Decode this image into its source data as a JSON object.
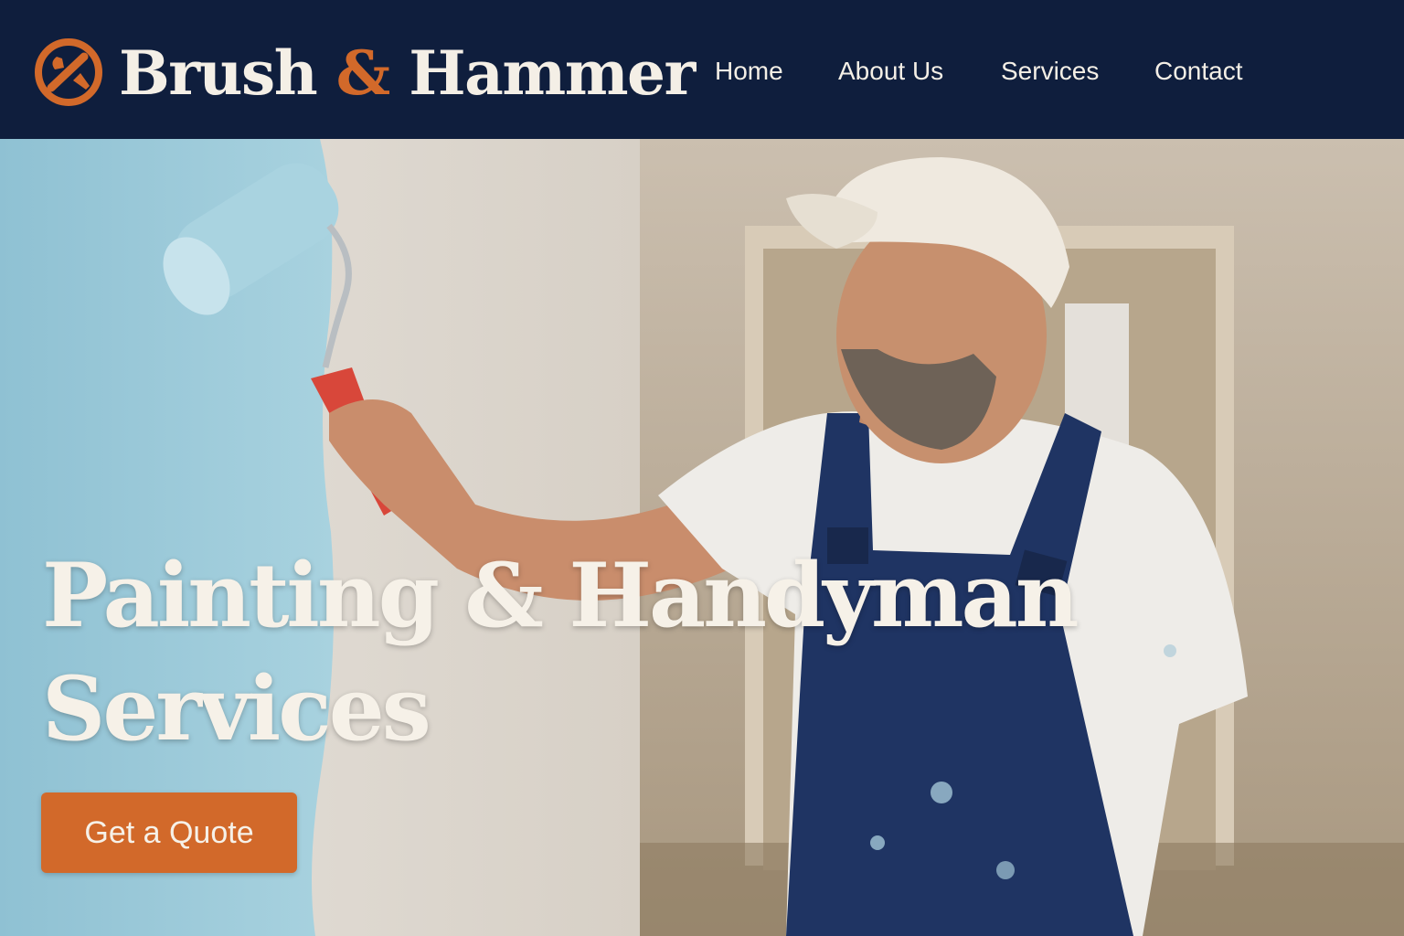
{
  "brand": {
    "name_part1": "Brush ",
    "ampersand": "&",
    "name_part2": " Hammer",
    "logo_icon": "wrench-brush-badge-icon"
  },
  "nav": {
    "items": [
      {
        "label": "Home"
      },
      {
        "label": "About Us"
      },
      {
        "label": "Services"
      },
      {
        "label": "Contact"
      }
    ]
  },
  "hero": {
    "headline_line1": "Painting & Handyman",
    "headline_line2": "Services",
    "cta_label": "Get a Quote",
    "image": "painter-rolling-blue-paint-photo"
  },
  "colors": {
    "header_bg": "#0f1e3d",
    "accent": "#d2692a",
    "text_light": "#f4efe6",
    "paint_blue": "#9cc9d8"
  }
}
